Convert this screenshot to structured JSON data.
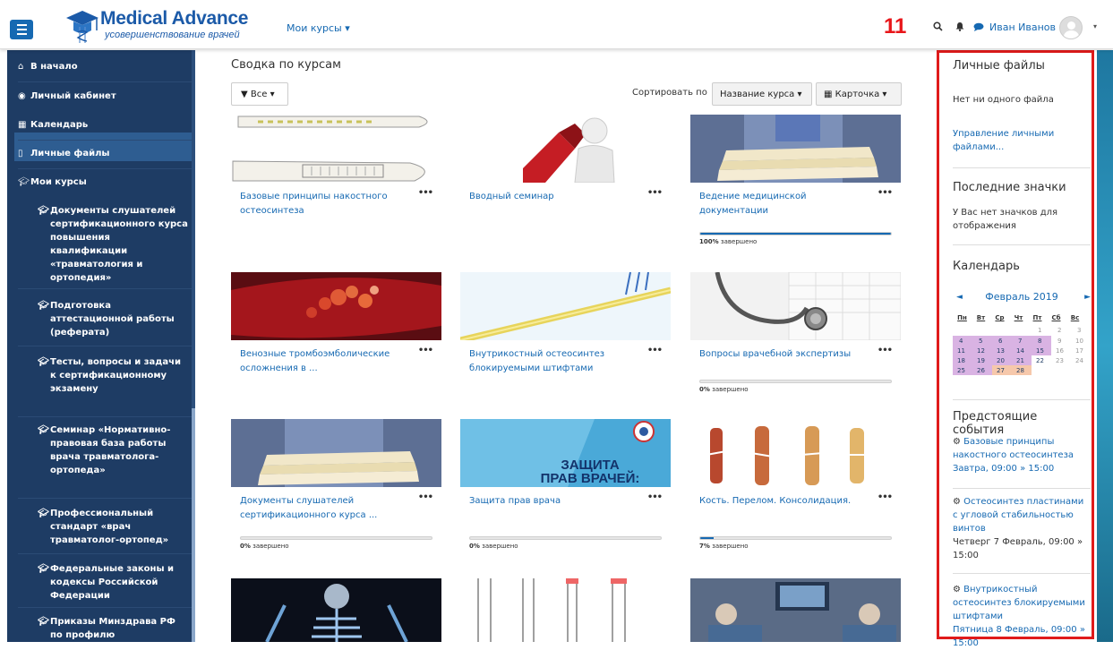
{
  "header": {
    "logo_title": "Medical Advance",
    "logo_subtitle": "усовершенствование врачей",
    "my_courses_menu": "Мои курсы ▾",
    "notification_count": "11",
    "search_icon": "search-icon",
    "bell_icon": "bell-icon",
    "chat_icon": "chat-icon",
    "user_name": "Иван Иванов",
    "user_caret": "▾"
  },
  "sidebar": {
    "home": "В начало",
    "dashboard": "Личный кабинет",
    "calendar": "Календарь",
    "private_files": "Личные файлы",
    "my_courses": "Мои курсы",
    "courses": [
      "Документы слушателей сертификационного курса повышения квалификации «травматология и ортопедия»",
      "Подготовка аттестационной работы (реферата)",
      "Тесты, вопросы и задачи к сертификационному экзамену",
      "Семинар «Нормативно-правовая база работы врача травматолога-ортопеда»",
      "Профессиональный стандарт «врач травматолог-ортопед»",
      "Федеральные законы и кодексы Российской Федерации",
      "Приказы Минздрава РФ по профилю"
    ]
  },
  "main": {
    "title": "Сводка по курсам",
    "filter_label": "Все ▾",
    "sort_label": "Сортировать по",
    "sort_value": "Название курса ▾",
    "view_value": "Карточка ▾",
    "dots": "•••",
    "progress_suffix": "завершено",
    "cards": [
      {
        "title": "Базовые принципы накостного остеосинтеза",
        "progress_label": "",
        "progress": null
      },
      {
        "title": "Вводный семинар",
        "progress_label": "",
        "progress": null
      },
      {
        "title": "Ведение медицинской документации",
        "progress_label": "100%",
        "progress": 100
      },
      {
        "title": "Венозные тромбоэмболические осложнения в ...",
        "progress_label": "",
        "progress": null
      },
      {
        "title": "Внутрикостный остеосинтез блокируемыми штифтами",
        "progress_label": "",
        "progress": null
      },
      {
        "title": "Вопросы врачебной экспертизы",
        "progress_label": "0%",
        "progress": 0
      },
      {
        "title": "Документы слушателей сертификационного курса ...",
        "progress_label": "0%",
        "progress": 0
      },
      {
        "title": "Защита прав врача",
        "progress_label": "0%",
        "progress": 0
      },
      {
        "title": "Кость. Перелом. Консолидация.",
        "progress_label": "7%",
        "progress": 7
      }
    ],
    "zashchita_line1": "ЗАЩИТА",
    "zashchita_line2": "ПРАВ ВРАЧЕЙ:"
  },
  "right": {
    "files_title": "Личные файлы",
    "files_empty": "Нет ни одного файла",
    "files_manage": "Управление личными файлами...",
    "badges_title": "Последние значки",
    "badges_empty": "У Вас нет значков для отображения",
    "calendar_title": "Календарь",
    "cal_month": "Февраль 2019",
    "cal_prev": "◄",
    "cal_next": "►",
    "cal_daynames": [
      "Пн",
      "Вт",
      "Ср",
      "Чт",
      "Пт",
      "Сб",
      "Вс"
    ],
    "upcoming_title": "Предстоящие события",
    "events": [
      {
        "title": "Базовые принципы накостного остеосинтеза",
        "time": "Завтра, 09:00 » 15:00"
      },
      {
        "title": "Остеосинтез пластинами с угловой стабильностью винтов",
        "time": "Четверг 7 Февраль, 09:00 » 15:00"
      },
      {
        "title": "Внутрикостный остеосинтез блокируемыми штифтами",
        "time": "Пятница 8 Февраль, 09:00 » 15:00"
      }
    ]
  },
  "colors": {
    "accent": "#1669b2",
    "sidebar": "#1e3c64",
    "highlight_box": "#e01b1b"
  }
}
